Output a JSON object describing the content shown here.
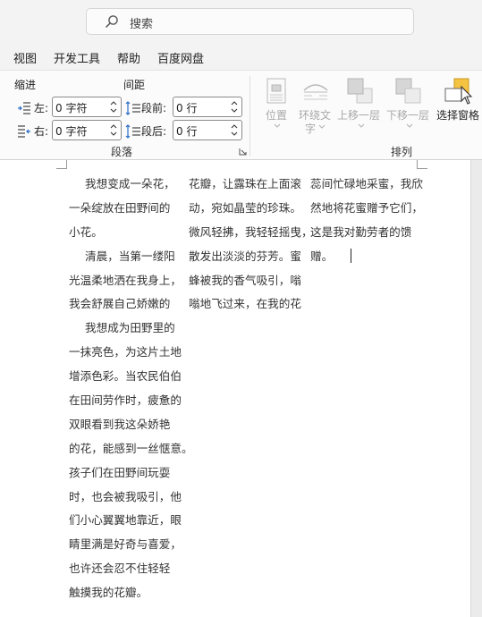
{
  "search": {
    "placeholder": "搜索"
  },
  "menu": {
    "tabs": [
      "视图",
      "开发工具",
      "帮助",
      "百度网盘"
    ]
  },
  "ribbon": {
    "indent": {
      "heading": "缩进",
      "left_label": "左:",
      "left_value": "0 字符",
      "right_label": "右:",
      "right_value": "0 字符"
    },
    "spacing": {
      "heading": "间距",
      "before_label": "段前:",
      "before_value": "0 行",
      "after_label": "段后:",
      "after_value": "0 行"
    },
    "paragraph_group_label": "段落",
    "arrange_group_label": "排列",
    "arrange_buttons": {
      "position": "位置",
      "wrap_line1": "环绕文",
      "wrap_line2": "字",
      "bring_forward": "上移一层",
      "send_backward": "下移一层",
      "selection_pane": "选择窗格"
    }
  },
  "document": {
    "col1": [
      "我想变成一朵花，",
      "一朵绽放在田野间的",
      "小花。",
      "清晨，当第一缕阳",
      "光温柔地洒在我身上，",
      "我会舒展自己娇嫩的",
      "我想成为田野里的",
      "一抹亮色，为这片土地",
      "增添色彩。当农民伯伯",
      "在田间劳作时，疲惫的",
      "双眼看到我这朵娇艳",
      "的花，能感到一丝惬意。",
      "孩子们在田野间玩耍",
      "时，也会被我吸引，他",
      "们小心翼翼地靠近，眼",
      "睛里满是好奇与喜爱，",
      "也许还会忍不住轻轻",
      "触摸我的花瓣。"
    ],
    "col2": [
      "花瓣，让露珠在上面滚",
      "动，宛如晶莹的珍珠。",
      "微风轻拂，我轻轻摇曳，",
      "散发出淡淡的芬芳。蜜",
      "蜂被我的香气吸引，嗡",
      "嗡地飞过来，在我的花"
    ],
    "col3": [
      "蕊间忙碌地采蜜，我欣",
      "然地将花蜜赠予它们，",
      "这是我对勤劳者的馈",
      "赠。"
    ]
  },
  "colors": {
    "accent": "#f5c342",
    "page": "#ffffff",
    "background": "#f3f3f3"
  }
}
